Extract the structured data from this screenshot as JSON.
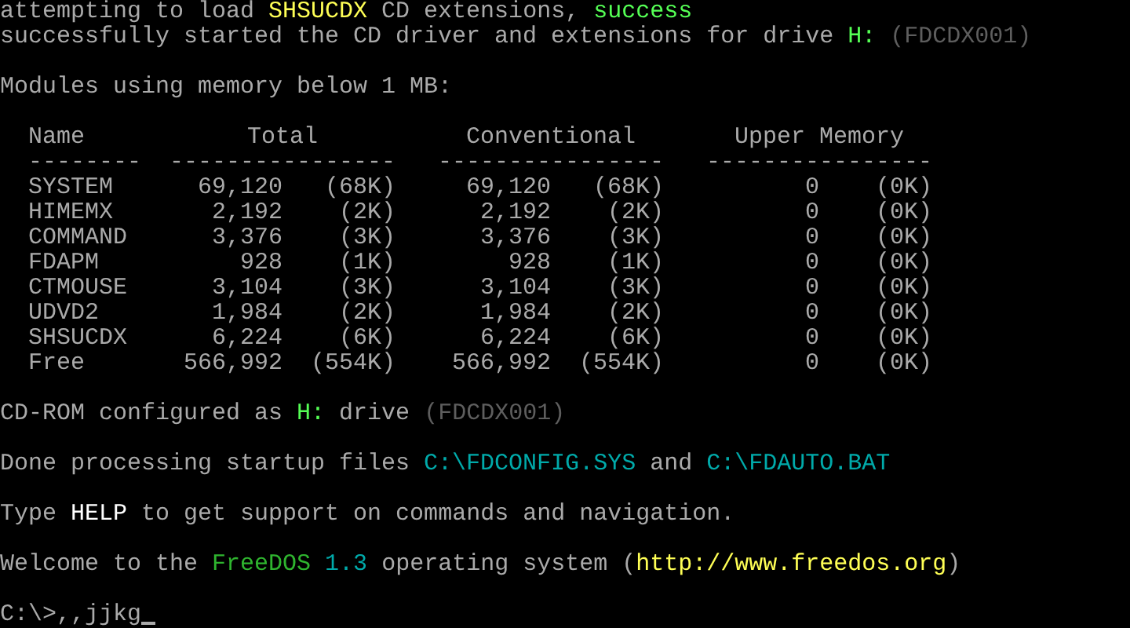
{
  "boot_lines": [
    {
      "segments": [
        {
          "text": "attempting to load ",
          "kind": "plain"
        },
        {
          "text": "SHSUCDX",
          "kind": "highlight"
        },
        {
          "text": " CD extensions, ",
          "kind": "plain"
        },
        {
          "text": "success",
          "kind": "success"
        }
      ]
    },
    {
      "segments": [
        {
          "text": "successfully started the CD driver and extensions for drive ",
          "kind": "plain"
        },
        {
          "text": "H:",
          "kind": "success"
        },
        {
          "text": " (FDCDX001)",
          "kind": "dim"
        }
      ]
    }
  ],
  "memory_heading": "Modules using memory below 1 MB:",
  "memory_table": {
    "columns": [
      {
        "label": "Name",
        "rule": "--------"
      },
      {
        "label": "Total",
        "rule": "----------------"
      },
      {
        "label": "Conventional",
        "rule": "----------------"
      },
      {
        "label": "Upper Memory",
        "rule": "----------------"
      }
    ],
    "rows": [
      {
        "name": "SYSTEM",
        "total": "69,120",
        "total_k": "(68K)",
        "conventional": "69,120",
        "conventional_k": "(68K)",
        "upper": "0",
        "upper_k": "(0K)"
      },
      {
        "name": "HIMEMX",
        "total": "2,192",
        "total_k": "(2K)",
        "conventional": "2,192",
        "conventional_k": "(2K)",
        "upper": "0",
        "upper_k": "(0K)"
      },
      {
        "name": "COMMAND",
        "total": "3,376",
        "total_k": "(3K)",
        "conventional": "3,376",
        "conventional_k": "(3K)",
        "upper": "0",
        "upper_k": "(0K)"
      },
      {
        "name": "FDAPM",
        "total": "928",
        "total_k": "(1K)",
        "conventional": "928",
        "conventional_k": "(1K)",
        "upper": "0",
        "upper_k": "(0K)"
      },
      {
        "name": "CTMOUSE",
        "total": "3,104",
        "total_k": "(3K)",
        "conventional": "3,104",
        "conventional_k": "(3K)",
        "upper": "0",
        "upper_k": "(0K)"
      },
      {
        "name": "UDVD2",
        "total": "1,984",
        "total_k": "(2K)",
        "conventional": "1,984",
        "conventional_k": "(2K)",
        "upper": "0",
        "upper_k": "(0K)"
      },
      {
        "name": "SHSUCDX",
        "total": "6,224",
        "total_k": "(6K)",
        "conventional": "6,224",
        "conventional_k": "(6K)",
        "upper": "0",
        "upper_k": "(0K)"
      },
      {
        "name": "Free",
        "total": "566,992",
        "total_k": "(554K)",
        "conventional": "566,992",
        "conventional_k": "(554K)",
        "upper": "0",
        "upper_k": "(0K)"
      }
    ]
  },
  "messages": [
    {
      "segments": [
        {
          "text": "CD-ROM configured as ",
          "kind": "plain"
        },
        {
          "text": "H:",
          "kind": "success"
        },
        {
          "text": " drive ",
          "kind": "plain"
        },
        {
          "text": "(FDCDX001)",
          "kind": "dim"
        }
      ]
    },
    {
      "segments": [
        {
          "text": "Done processing startup files ",
          "kind": "plain"
        },
        {
          "text": "C:\\FDCONFIG.SYS",
          "kind": "path"
        },
        {
          "text": " and ",
          "kind": "plain"
        },
        {
          "text": "C:\\FDAUTO.BAT",
          "kind": "path"
        }
      ]
    },
    {
      "segments": [
        {
          "text": "Type ",
          "kind": "plain"
        },
        {
          "text": "HELP",
          "kind": "bright"
        },
        {
          "text": " to get support on commands and navigation.",
          "kind": "plain"
        }
      ]
    },
    {
      "segments": [
        {
          "text": "Welcome to the ",
          "kind": "plain"
        },
        {
          "text": "FreeDOS",
          "kind": "brand"
        },
        {
          "text": " 1.3",
          "kind": "path"
        },
        {
          "text": " operating system (",
          "kind": "plain"
        },
        {
          "text": "http://www.freedos.org",
          "kind": "highlight"
        },
        {
          "text": ")",
          "kind": "plain"
        }
      ]
    }
  ],
  "prompt": {
    "text": "C:\\>,,jjkg"
  }
}
